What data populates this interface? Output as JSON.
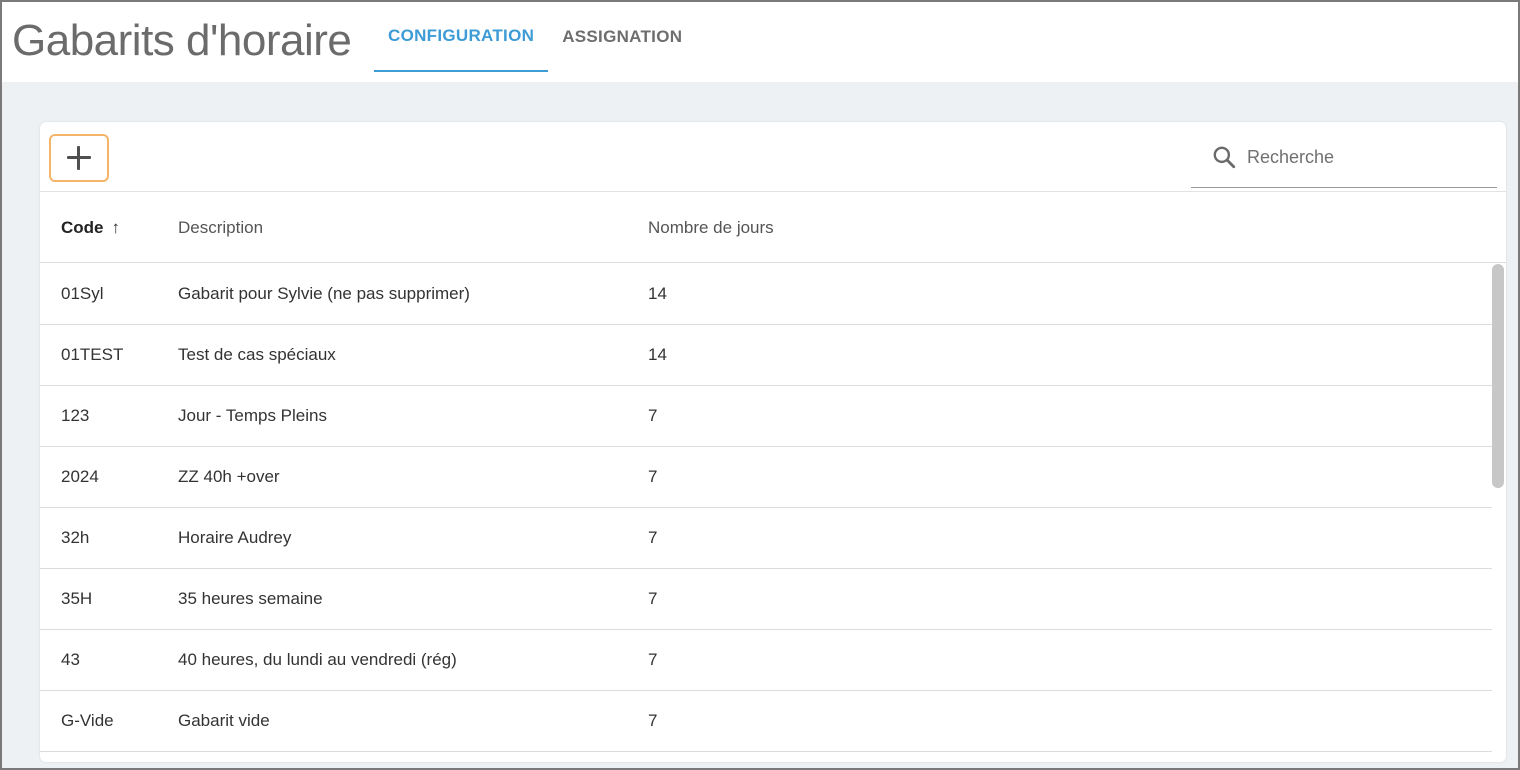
{
  "header": {
    "title": "Gabarits d'horaire",
    "tabs": [
      {
        "label": "CONFIGURATION",
        "active": true
      },
      {
        "label": "ASSIGNATION",
        "active": false
      }
    ]
  },
  "toolbar": {
    "add_icon": "plus-icon",
    "search": {
      "icon": "search-icon",
      "placeholder": "Recherche",
      "value": ""
    }
  },
  "table": {
    "columns": [
      {
        "label": "Code",
        "sorted": "ascending",
        "sort_icon": "↑"
      },
      {
        "label": "Description"
      },
      {
        "label": "Nombre de jours"
      }
    ],
    "rows": [
      {
        "code": "01Syl",
        "description": "Gabarit pour Sylvie (ne pas supprimer)",
        "days": "14"
      },
      {
        "code": "01TEST",
        "description": "Test de cas spéciaux",
        "days": "14"
      },
      {
        "code": "123",
        "description": "Jour - Temps Pleins",
        "days": "7"
      },
      {
        "code": "2024",
        "description": "ZZ 40h +over",
        "days": "7"
      },
      {
        "code": "32h",
        "description": "Horaire Audrey",
        "days": "7"
      },
      {
        "code": "35H",
        "description": "35 heures semaine",
        "days": "7"
      },
      {
        "code": "43",
        "description": "40 heures, du lundi au vendredi (rég)",
        "days": "7"
      },
      {
        "code": "G-Vide",
        "description": "Gabarit vide",
        "days": "7"
      }
    ]
  },
  "colors": {
    "accent": "#3d9bd6",
    "add_button_border": "#f4b56a",
    "content_background": "#eef1f4"
  }
}
